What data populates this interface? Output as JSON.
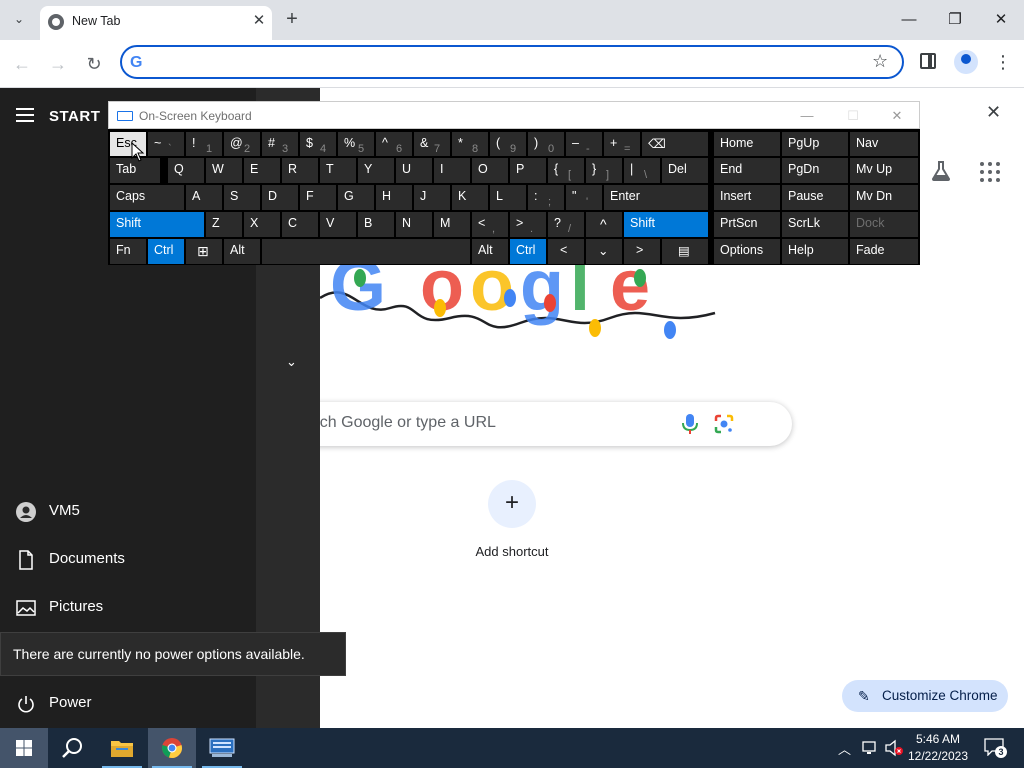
{
  "browser": {
    "tab_title": "New Tab",
    "omnibox_value": "",
    "search_placeholder": "Search Google or type a URL",
    "add_shortcut": "Add shortcut",
    "customize_chrome": "Customize Chrome",
    "ntp_close": "✕",
    "colors": {
      "accent": "#0b57d0",
      "tab_strip": "#dee1e6",
      "customize_bg": "#d3e3fd"
    }
  },
  "start_menu": {
    "title": "START",
    "items": [
      {
        "label": "VM5",
        "icon": "user-icon"
      },
      {
        "label": "Documents",
        "icon": "document-icon"
      },
      {
        "label": "Pictures",
        "icon": "pictures-icon"
      },
      {
        "label": "Power",
        "icon": "power-icon"
      }
    ],
    "power_tooltip": "There are currently no power options available."
  },
  "osk": {
    "title": "On-Screen Keyboard",
    "keys": {
      "esc": "Esc",
      "tilde_top": "~",
      "tilde_bot": "`",
      "n1_top": "!",
      "n1_bot": "1",
      "n2_top": "@",
      "n2_bot": "2",
      "n3_top": "#",
      "n3_bot": "3",
      "n4_top": "$",
      "n4_bot": "4",
      "n5_top": "%",
      "n5_bot": "5",
      "n6_top": "^",
      "n6_bot": "6",
      "n7_top": "&",
      "n7_bot": "7",
      "n8_top": "*",
      "n8_bot": "8",
      "n9_top": "(",
      "n9_bot": "9",
      "n0_top": ")",
      "n0_bot": "0",
      "minus_top": "–",
      "minus_bot": "-",
      "equals_top": "+",
      "equals_bot": "=",
      "backspace": "⌫",
      "tab": "Tab",
      "q": "Q",
      "w": "W",
      "e": "E",
      "r": "R",
      "t": "T",
      "y": "Y",
      "u": "U",
      "i": "I",
      "o": "O",
      "p": "P",
      "lbrace_top": "{",
      "lbrace_bot": "[",
      "rbrace_top": "}",
      "rbrace_bot": "]",
      "pipe_top": "|",
      "pipe_bot": "\\",
      "del": "Del",
      "caps": "Caps",
      "a": "A",
      "s": "S",
      "d": "D",
      "f": "F",
      "g": "G",
      "h": "H",
      "j": "J",
      "k": "K",
      "l": "L",
      "colon_top": ":",
      "colon_bot": ";",
      "quote_top": "\"",
      "quote_bot": "'",
      "enter": "Enter",
      "shift": "Shift",
      "z": "Z",
      "x": "X",
      "c": "C",
      "v": "V",
      "b": "B",
      "n": "N",
      "m": "M",
      "lt_top": "<",
      "lt_bot": ",",
      "gt_top": ">",
      "gt_bot": ".",
      "q_top": "?",
      "q_bot": "/",
      "up": "^",
      "shift_r": "Shift",
      "fn": "Fn",
      "ctrl": "Ctrl",
      "win": "⊞",
      "alt": "Alt",
      "space": "",
      "alt_r": "Alt",
      "ctrl_r": "Ctrl",
      "left": "<",
      "down": "⌄",
      "right": ">",
      "menu": "▤",
      "home": "Home",
      "pgup": "PgUp",
      "nav": "Nav",
      "end": "End",
      "pgdn": "PgDn",
      "mvup": "Mv Up",
      "insert": "Insert",
      "pause": "Pause",
      "mvdn": "Mv Dn",
      "prtscn": "PrtScn",
      "scrlk": "ScrLk",
      "dock": "Dock",
      "options": "Options",
      "help": "Help",
      "fade": "Fade"
    }
  },
  "taskbar": {
    "time": "5:46 AM",
    "date": "12/22/2023",
    "notification_count": "3"
  }
}
